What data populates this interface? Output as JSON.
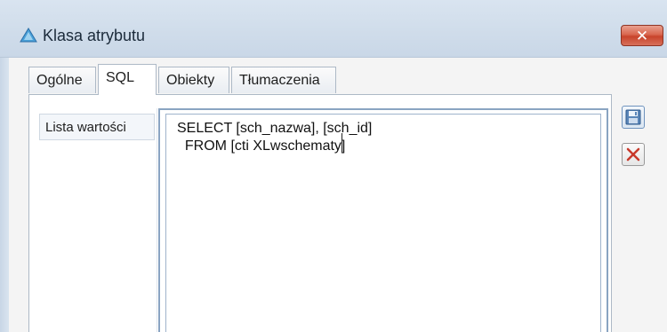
{
  "window": {
    "title": "Klasa atrybutu",
    "icon": "app-triangle-icon",
    "close_label": "✕"
  },
  "tabs": [
    {
      "label": "Ogólne",
      "active": false
    },
    {
      "label": "SQL",
      "active": true
    },
    {
      "label": "Obiekty",
      "active": false
    },
    {
      "label": "Tłumaczenia",
      "active": false
    }
  ],
  "sql_tab": {
    "field_label": "Lista wartości",
    "query_lines": [
      "SELECT [sch_nazwa], [sch_id]",
      "  FROM [cti XLwschematy]"
    ]
  },
  "toolbar": {
    "save_icon": "save-icon",
    "delete_icon": "delete-icon"
  },
  "colors": {
    "close_button": "#d9674f",
    "titlebar": "#d0dcea",
    "accent_border": "#8aa4c2"
  }
}
